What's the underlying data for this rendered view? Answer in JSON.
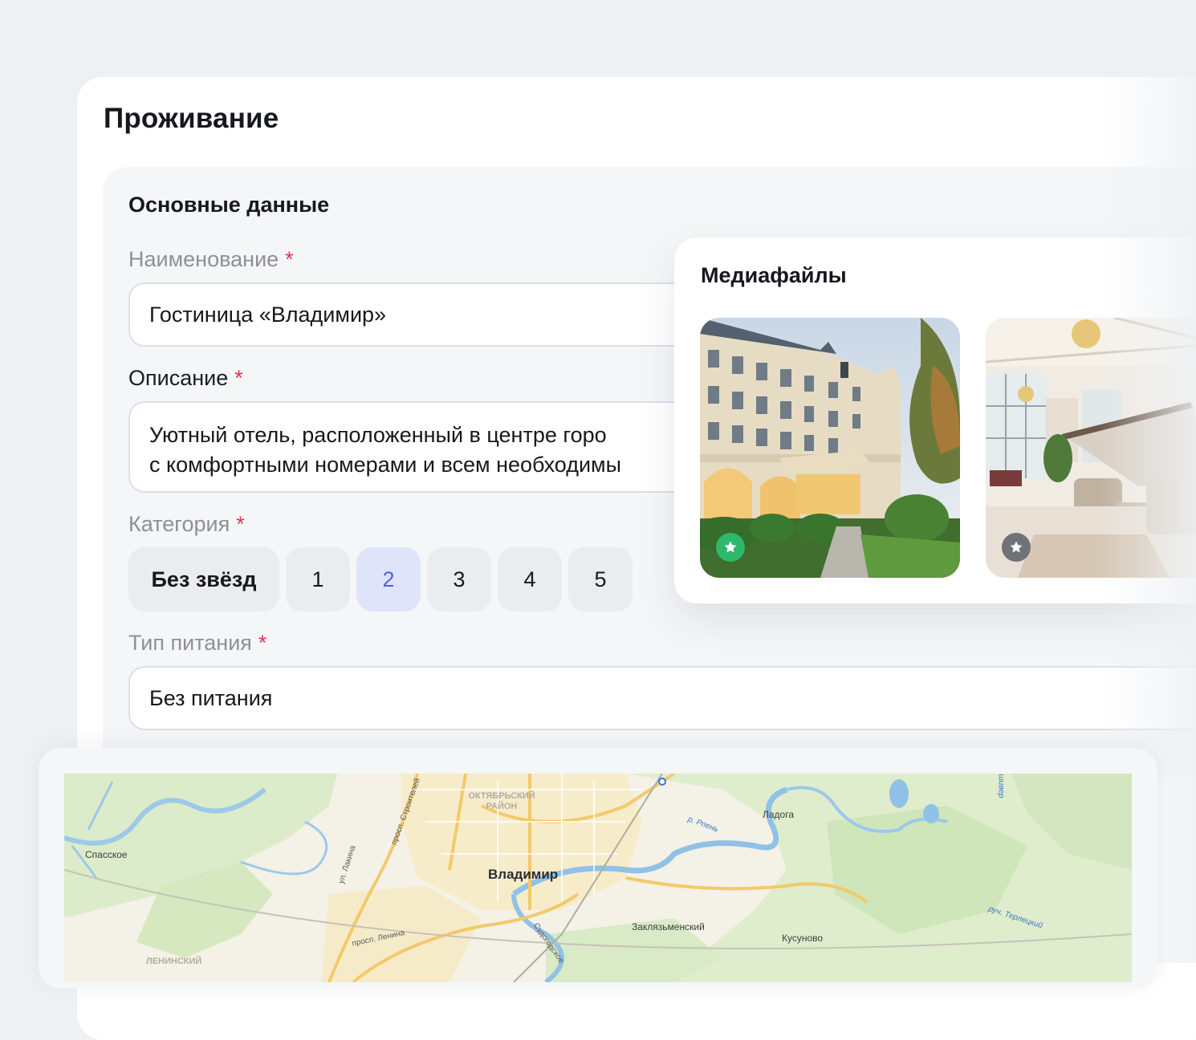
{
  "page": {
    "title": "Проживание"
  },
  "basic": {
    "title": "Основные данные",
    "name_label": "Наименование",
    "name_value": "Гостиница «Владимир»",
    "description_label": "Описание",
    "description_line1": "Уютный отель, расположенный в центре горо",
    "description_line2": "с комфортными номерами и всем необходимы",
    "category_label": "Категория",
    "category_options": [
      "Без звёзд",
      "1",
      "2",
      "3",
      "4",
      "5"
    ],
    "category_selected": "2",
    "meal_label": "Тип питания",
    "meal_value": "Без питания",
    "required_mark": "*"
  },
  "media": {
    "title": "Медиафайлы",
    "photos": [
      {
        "subject": "hotel-exterior",
        "main": true,
        "badge_color": "#2eb86a"
      },
      {
        "subject": "hotel-lobby",
        "main": false,
        "badge_color": "#6f7277"
      }
    ]
  },
  "map": {
    "labels": {
      "city": "Владимир",
      "district": "ОКТЯБРЬСКИЙ\nРАЙОН",
      "spasskoe": "Спасское",
      "ladoga": "Ладога",
      "zaklyazm": "Заклязьменский",
      "kusunovo": "Кусуново",
      "rpren": "р. Рпень",
      "lakina": "ул. Лакина",
      "stroiteley": "просп. Строителей",
      "lenina": "просп. Ленина",
      "sudogodskoe": "Судогодское",
      "terletsky": "руч. Терлецкий",
      "leninsky": "ЛЕНИНСКИЙ",
      "shiver": "шивер"
    }
  },
  "colors": {
    "accent": "#4b63e6",
    "accent_bg": "#dfe4fb",
    "required": "#e0354d",
    "main_badge": "#2eb86a"
  }
}
